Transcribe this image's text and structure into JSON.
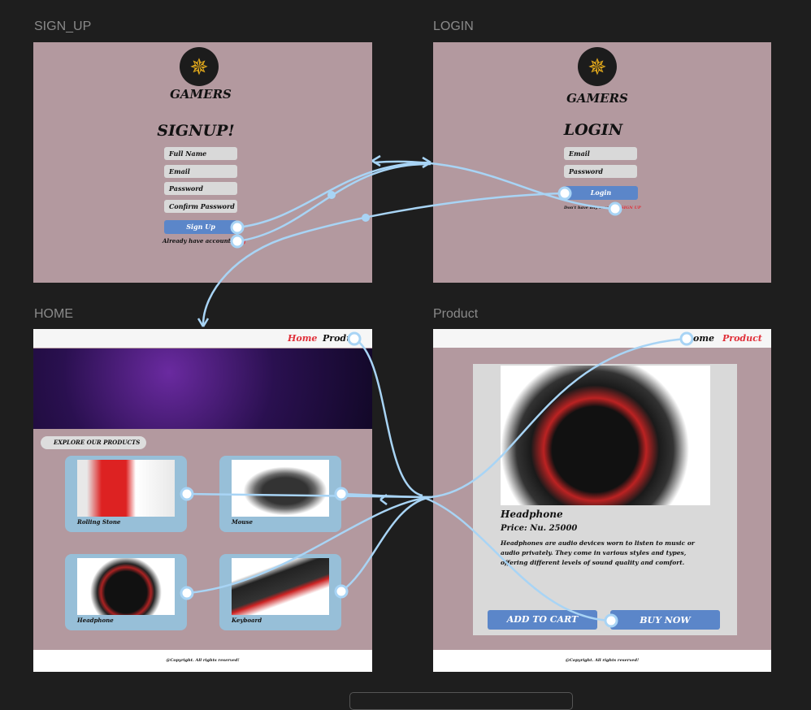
{
  "frames": {
    "signup": "SIGN_UP",
    "login": "LOGIN",
    "home": "HOME",
    "product": "Product"
  },
  "signup": {
    "brand": "GAMERS",
    "title": "SIGNUP!",
    "fields": [
      "Full Name",
      "Email",
      "Password",
      "Confirm Password"
    ],
    "button": "Sign Up",
    "already": "Already have account?",
    "login_link": "Log"
  },
  "login": {
    "brand": "GAMERS",
    "title": "LOGIN",
    "fields": [
      "Email",
      "Password"
    ],
    "button": "Login",
    "no_account": "Don't have any account?",
    "signup_link": "SIGN UP"
  },
  "home": {
    "nav": {
      "home": "Home",
      "product": "Produ"
    },
    "explore": "EXPLORE OUR PRODUCTS",
    "cards": [
      "Rolling Stone",
      "Mouse",
      "Headphone",
      "Keyboard"
    ],
    "footer": "@Copyright. All rights reserved!"
  },
  "product": {
    "nav": {
      "home": "ome",
      "product": "Product"
    },
    "name": "Headphone",
    "price": "Price: Nu. 25000",
    "description": "Headphones are audio devices worn to listen to music or audio privately. They come in various styles and types, offering different levels of sound quality and comfort.",
    "add_to_cart": "ADD TO CART",
    "buy_now": "BUY NOW",
    "footer": "@Copyright. All rights reserved!"
  },
  "colors": {
    "frame_bg": "#b3999f",
    "accent": "#5b86c9",
    "link_red": "#e0303a",
    "connector": "#a8d4f5",
    "card": "#97bfd8"
  }
}
